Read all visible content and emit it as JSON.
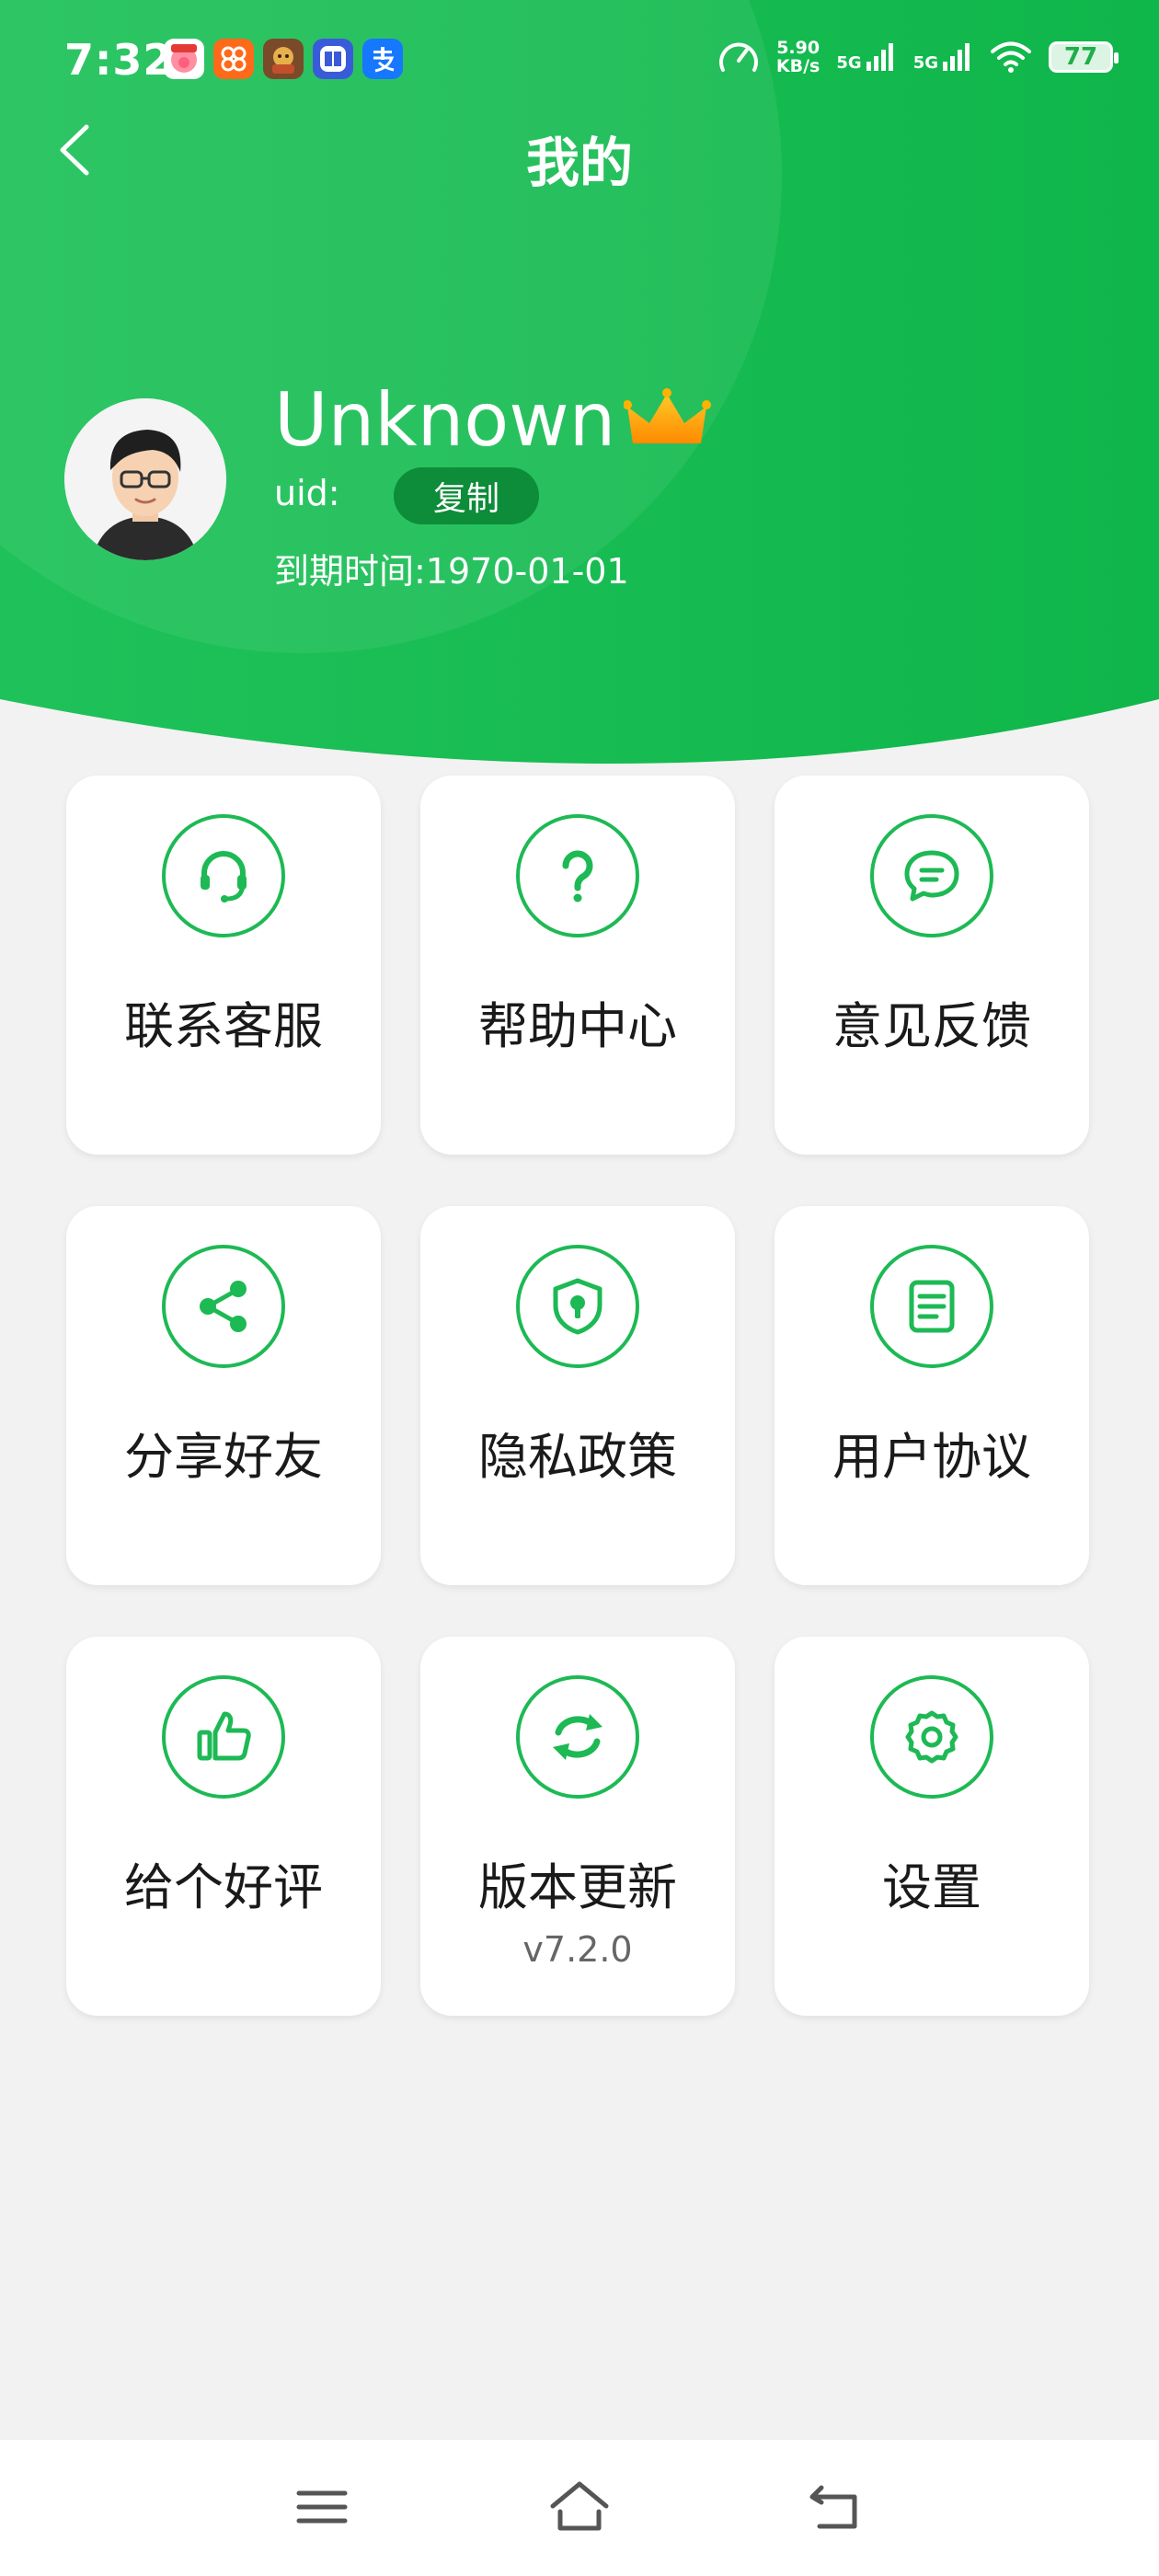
{
  "status_bar": {
    "time": "7:32",
    "net_speed_value": "5.90",
    "net_speed_unit": "KB/s",
    "signal_1": "5G",
    "signal_2": "5G",
    "battery": "77",
    "app_icons": [
      "piggy-app-icon",
      "orange-app-icon",
      "game-app-icon",
      "tieba-app-icon",
      "alipay-app-icon"
    ]
  },
  "nav": {
    "title": "我的"
  },
  "profile": {
    "username": "Unknown",
    "uid_label": "uid:",
    "copy_label": "复制",
    "expire_text": "到期时间:1970-01-01"
  },
  "menu": {
    "items": [
      {
        "label": "联系客服",
        "icon": "headset-icon"
      },
      {
        "label": "帮助中心",
        "icon": "question-icon"
      },
      {
        "label": "意见反馈",
        "icon": "chat-icon"
      },
      {
        "label": "分享好友",
        "icon": "share-icon"
      },
      {
        "label": "隐私政策",
        "icon": "shield-lock-icon"
      },
      {
        "label": "用户协议",
        "icon": "document-icon"
      },
      {
        "label": "给个好评",
        "icon": "thumbs-up-icon"
      },
      {
        "label": "版本更新",
        "icon": "refresh-icon",
        "sub": "v7.2.0"
      },
      {
        "label": "设置",
        "icon": "gear-icon"
      }
    ]
  },
  "colors": {
    "brand_green": "#1db954",
    "header_green": "#12b84a",
    "copy_button": "#0d8c39",
    "background": "#f2f2f2"
  }
}
